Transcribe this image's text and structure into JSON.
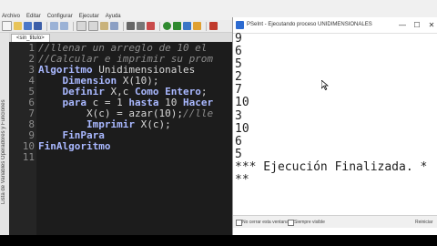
{
  "menubar": {
    "items": [
      "Archivo",
      "Editar",
      "Configurar",
      "Ejecutar",
      "Ayuda"
    ]
  },
  "editor": {
    "tab_label": "<sin_titulo>",
    "side_label": "Lista de Variables  Operadores y Funciones",
    "line_numbers": [
      "1",
      "2",
      "3",
      "4",
      "5",
      "6",
      "7",
      "8",
      "9",
      "10",
      "11"
    ],
    "lines": [
      [
        {
          "t": "//llenar un arreglo de 10 el",
          "c": "cm"
        }
      ],
      [
        {
          "t": "//Calcular e imprimir su prom",
          "c": "cm"
        }
      ],
      [
        {
          "t": "Algoritmo",
          "c": "kw"
        },
        {
          "t": " Unidimensionales",
          "c": "fn"
        }
      ],
      [
        {
          "t": "    ",
          "c": "fn"
        },
        {
          "t": "Dimension",
          "c": "kw"
        },
        {
          "t": " X(10);",
          "c": "fn"
        }
      ],
      [
        {
          "t": "    ",
          "c": "fn"
        },
        {
          "t": "Definir",
          "c": "kw"
        },
        {
          "t": " X,c ",
          "c": "fn"
        },
        {
          "t": "Como Entero",
          "c": "kw"
        },
        {
          "t": ";",
          "c": "fn"
        }
      ],
      [
        {
          "t": "    ",
          "c": "fn"
        },
        {
          "t": "para",
          "c": "kw"
        },
        {
          "t": " c = 1 ",
          "c": "fn"
        },
        {
          "t": "hasta",
          "c": "kw"
        },
        {
          "t": " 10 ",
          "c": "fn"
        },
        {
          "t": "Hacer",
          "c": "kw"
        }
      ],
      [
        {
          "t": "        X(c) = azar(10);",
          "c": "fn"
        },
        {
          "t": "//lle",
          "c": "cm"
        }
      ],
      [
        {
          "t": "        ",
          "c": "fn"
        },
        {
          "t": "Imprimir",
          "c": "kw"
        },
        {
          "t": " X(c);",
          "c": "fn"
        }
      ],
      [
        {
          "t": "    ",
          "c": "fn"
        },
        {
          "t": "FinPara",
          "c": "kw"
        }
      ],
      [
        {
          "t": "FinAlgoritmo",
          "c": "kw"
        }
      ],
      [
        {
          "t": "",
          "c": "fn"
        }
      ]
    ]
  },
  "console": {
    "title": "PSeInt - Ejecutando proceso UNIDIMENSIONALES",
    "minimize": "—",
    "maximize": "☐",
    "close": "✕",
    "output_lines": [
      "9",
      "6",
      "5",
      "2",
      "7",
      "10",
      "3",
      "10",
      "6",
      "5",
      "*** Ejecución Finalizada. *",
      "**"
    ],
    "status_keep_open": "No cerrar esta ventana",
    "status_always_visible": "Siempre visible",
    "status_right": "Reiniciar"
  }
}
